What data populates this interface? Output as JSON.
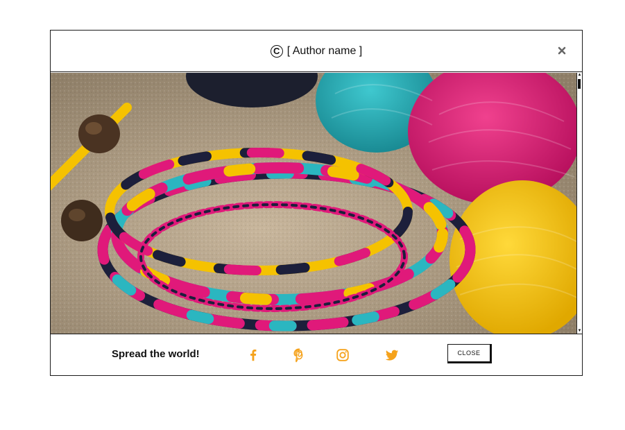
{
  "header": {
    "copyright_symbol": "C",
    "author": "[ Author name ]",
    "close_icon": "close-icon"
  },
  "image": {
    "subject": "photo-placeholder",
    "accent_colors": [
      "#e0197a",
      "#2bb6c0",
      "#f5c200",
      "#1c1f3b"
    ]
  },
  "footer": {
    "spread_label": "Spread the world!",
    "social_icons": [
      "facebook-icon",
      "pinterest-icon",
      "instagram-icon",
      "twitter-icon"
    ],
    "icon_color": "#f5a21b",
    "close_label": "CLOSE"
  }
}
